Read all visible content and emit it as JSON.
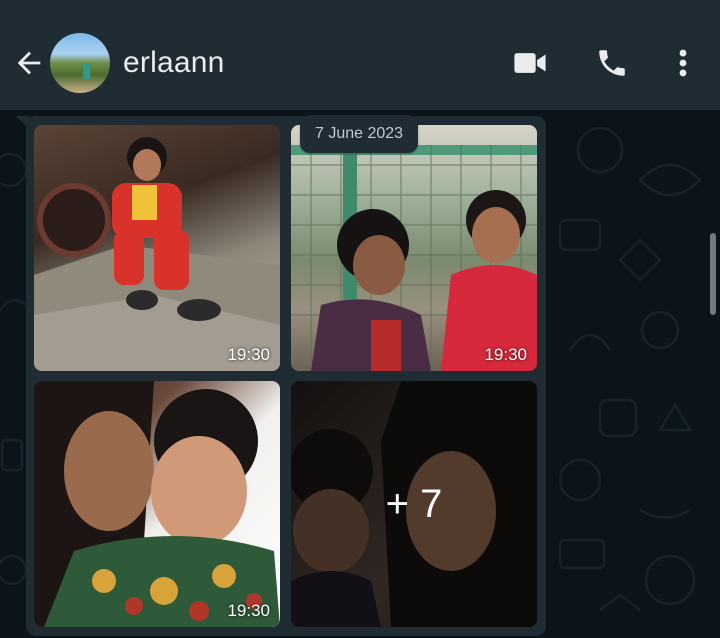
{
  "header": {
    "contact_name": "erlaann",
    "back_icon": "arrow-left-icon",
    "video_icon": "video-camera-icon",
    "call_icon": "phone-icon",
    "more_icon": "more-vertical-icon"
  },
  "chat": {
    "date_separator": "7 June 2023",
    "photos": [
      {
        "time": "19:30"
      },
      {
        "time": "19:30"
      },
      {
        "time": "19:30"
      },
      {
        "overlay": "+ 7"
      }
    ]
  },
  "colors": {
    "header_bg": "#1f2c34",
    "chat_bg": "#0b141a",
    "bubble_bg": "#202c33",
    "text_primary": "#e9edef"
  }
}
